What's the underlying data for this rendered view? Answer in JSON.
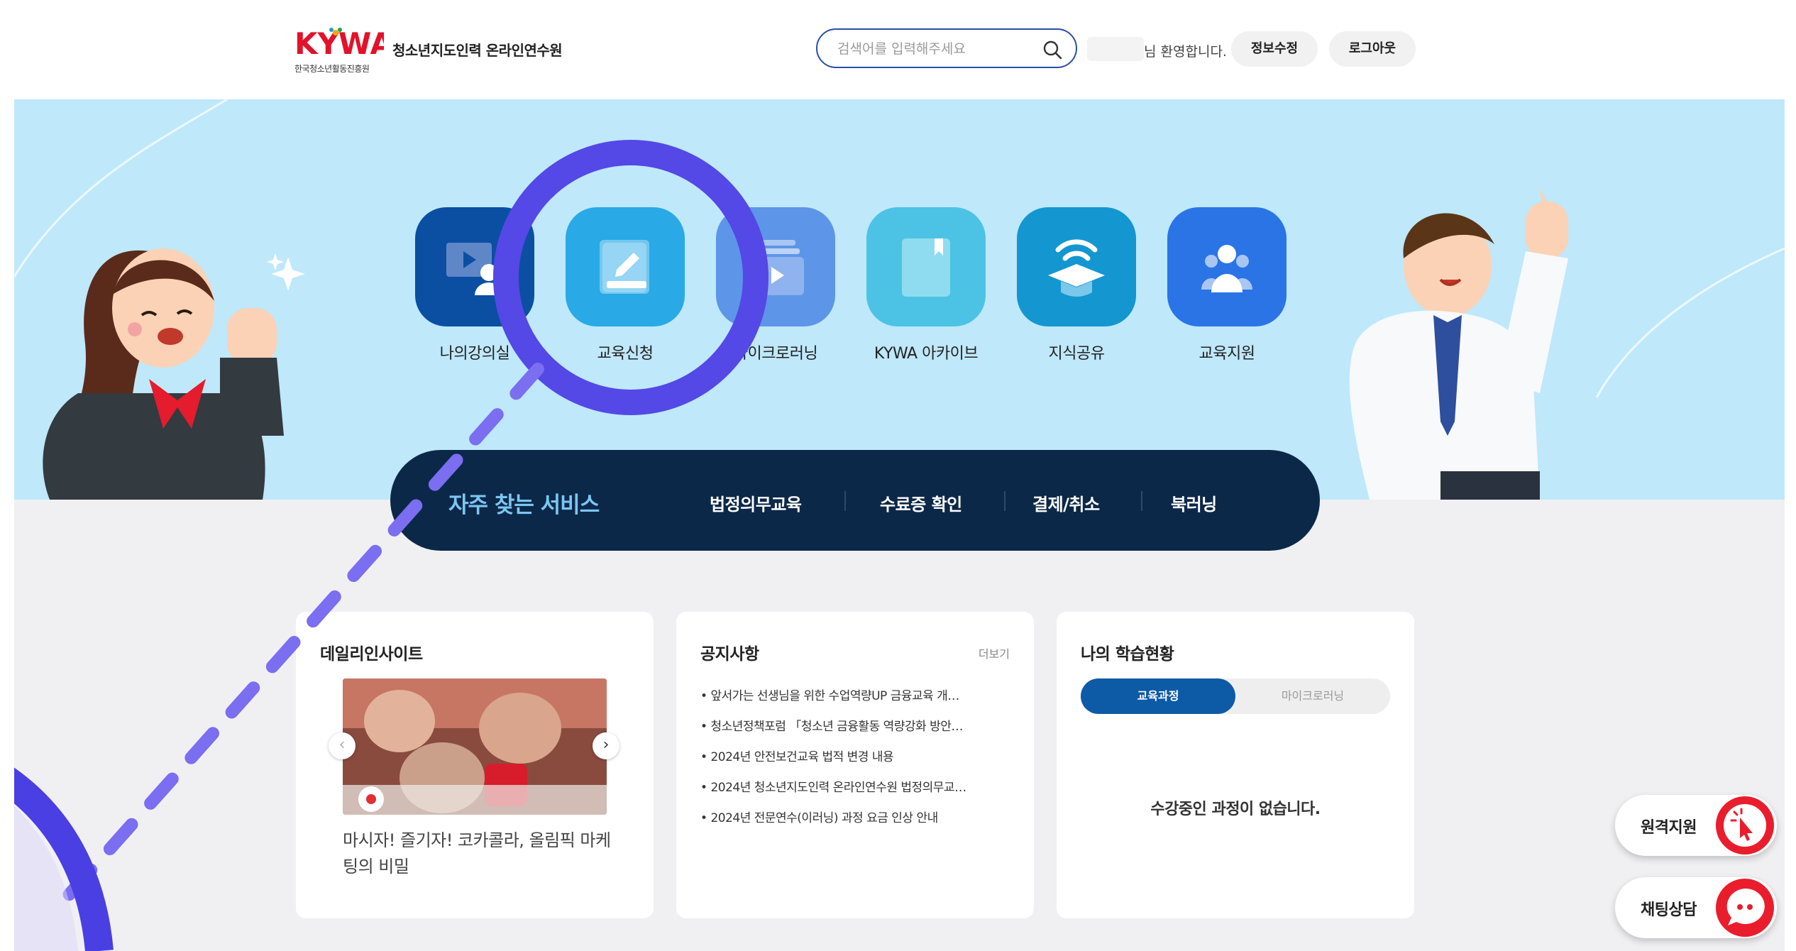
{
  "header": {
    "logo_text": "KYWA",
    "logo_subtext": "한국청소년활동진흥원",
    "site_name": "청소년지도인력 온라인연수원",
    "search_placeholder": "검색어를 입력해주세요",
    "welcome": "님 환영합니다.",
    "edit_info": "정보수정",
    "logout": "로그아웃"
  },
  "main_menu": [
    {
      "label": "나의강의실",
      "icon": "monitor-person-icon",
      "color": "#0b4fa3"
    },
    {
      "label": "교육신청",
      "icon": "edit-icon",
      "color": "#29a9e6"
    },
    {
      "label": "마이크로러닝",
      "icon": "video-folder-icon",
      "color": "#5d95e8"
    },
    {
      "label": "KYWA 아카이브",
      "icon": "book-icon",
      "color": "#4cc3e5"
    },
    {
      "label": "지식공유",
      "icon": "graduation-cap-wifi-icon",
      "color": "#1496d0"
    },
    {
      "label": "교육지원",
      "icon": "people-icon",
      "color": "#2a74e6"
    }
  ],
  "quick_services": {
    "title": "자주 찾는 서비스",
    "items": [
      "법정의무교육",
      "수료증 확인",
      "결제/취소",
      "북러닝"
    ]
  },
  "daily_insight": {
    "title": "데일리인사이트",
    "caption": "마시자! 즐기자! 코카콜라, 올림픽 마케팅의 비밀",
    "prev": "‹",
    "next": "›"
  },
  "notices": {
    "title": "공지사항",
    "more": "더보기",
    "items": [
      "앞서가는 선생님을 위한 수업역량UP 금융교육 개…",
      "청소년정책포럼 「청소년 금융활동 역량강화 방안…",
      "2024년 안전보건교육 법적 변경 내용",
      "2024년 청소년지도인력 온라인연수원 법정의무교…",
      "2024년 전문연수(이러닝) 과정 요금 인상 안내"
    ]
  },
  "learning_status": {
    "title": "나의 학습현황",
    "tabs": [
      "교육과정",
      "마이크로러닝"
    ],
    "active_tab": "교육과정",
    "empty_message": "수강중인 과정이 없습니다."
  },
  "floating": {
    "remote_support": "원격지원",
    "chat": "채팅상담"
  },
  "colors": {
    "accent": "#5448e6",
    "hero_bg": "#bfe8fa",
    "quick_bar": "#0c2849",
    "toggle_active": "#0d5aa7",
    "float_red": "#ea1d2c"
  }
}
